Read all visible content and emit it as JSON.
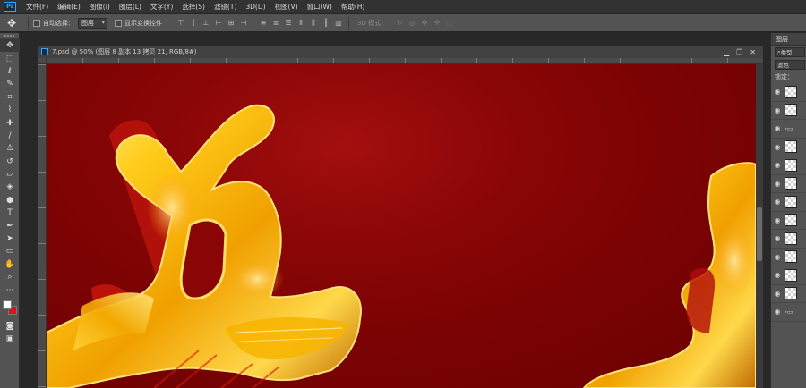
{
  "menubar": {
    "items": [
      "文件(F)",
      "编辑(E)",
      "图像(I)",
      "图层(L)",
      "文字(Y)",
      "选择(S)",
      "滤镜(T)",
      "3D(D)",
      "视图(V)",
      "窗口(W)",
      "帮助(H)"
    ],
    "logo": "Ps"
  },
  "options": {
    "auto_select_label": "自动选择：",
    "auto_select_value": "图层",
    "show_transform_label": "显示变换控件",
    "mode_3d_label": "3D 模式："
  },
  "document": {
    "tab_title": "7.psd @ 50% (图层 8 副本 13 拷贝 21, RGB/8#)",
    "controls": {
      "minimize": "▁",
      "restore": "❐",
      "close": "✕"
    }
  },
  "layers_panel": {
    "tab_label": "图层",
    "search_label": "类型",
    "blend_mode": "滤色",
    "lock_label": "锁定："
  },
  "colors": {
    "foreground": "#ffffff",
    "background": "#e0101e",
    "canvas_red": "#8a0606",
    "gold": "#f5b800"
  },
  "icons": {
    "move_tool": "move-icon",
    "eye": "eye-icon"
  }
}
